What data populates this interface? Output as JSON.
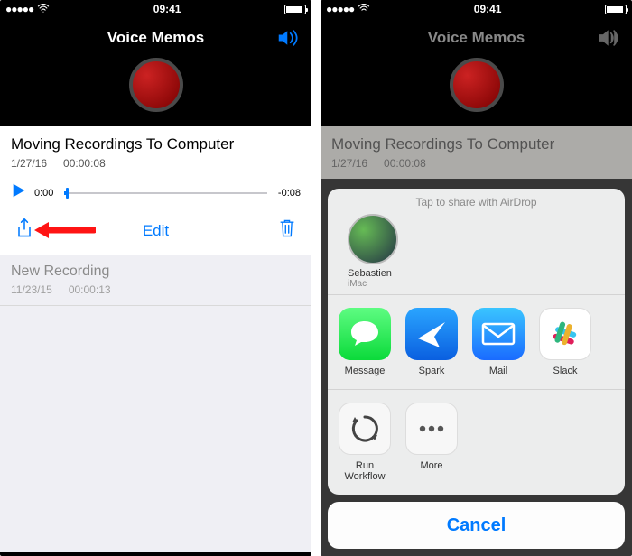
{
  "statusbar": {
    "time": "09:41"
  },
  "header": {
    "title": "Voice Memos"
  },
  "selected": {
    "title": "Moving Recordings To Computer",
    "date": "1/27/16",
    "duration": "00:00:08",
    "elapsed": "0:00",
    "remaining": "-0:08",
    "edit": "Edit"
  },
  "list": {
    "items": [
      {
        "title": "New Recording",
        "date": "11/23/15",
        "duration": "00:00:13"
      }
    ]
  },
  "sheet": {
    "airdrop_title": "Tap to share with AirDrop",
    "contact_name": "Sebastien",
    "contact_device": "iMac",
    "apps": [
      {
        "label": "Message"
      },
      {
        "label": "Spark"
      },
      {
        "label": "Mail"
      },
      {
        "label": "Slack"
      }
    ],
    "actions": [
      {
        "label": "Run Workflow"
      },
      {
        "label": "More"
      }
    ],
    "cancel": "Cancel"
  }
}
